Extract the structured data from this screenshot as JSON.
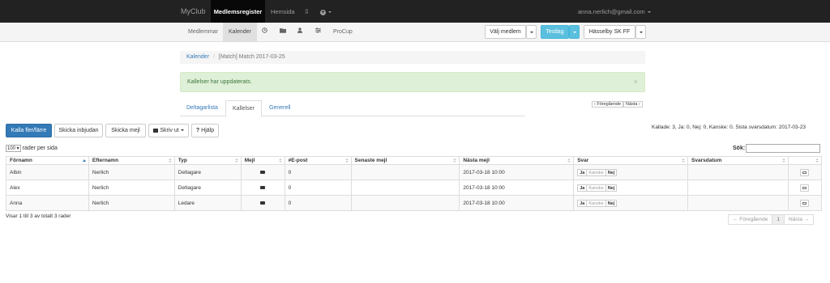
{
  "topnav": {
    "brand": "MyClub",
    "active": "Medlemsregister",
    "hemsida": "Hemsida",
    "user": "anna.nerlich@gmail.com"
  },
  "subnav": {
    "members": "Medlemmar",
    "calendar": "Kalender",
    "procup": "ProCup",
    "valj_medlem": "Välj medlem",
    "testlag": "Testlag",
    "club": "Hässelby SK FF"
  },
  "breadcrumb": {
    "link": "Kalender",
    "sep": "/",
    "current": "[Match] Match 2017-03-25"
  },
  "alert": {
    "text": "Kallelser har uppdaterats.",
    "close": "×"
  },
  "tabs": [
    "Deltagarlista",
    "Kallelser",
    "Generell"
  ],
  "small_pager": {
    "prev": "‹ Föregående",
    "next": "Nästa ›"
  },
  "actions": {
    "kalla": "Kalla fler/färre",
    "skicka_inbjudan": "Skicka inbjudan",
    "skicka_mejl": "Skicka mejl",
    "skriv_ut": "Skriv ut",
    "hjalp": "Hjälp"
  },
  "summary": "Kallade: 3, Ja: 0, Nej: 0, Kanske: 0. Sista svarsdatum: 2017-03-23",
  "length": {
    "value": "100",
    "label": "rader per sida"
  },
  "search": {
    "label": "Sök:",
    "value": ""
  },
  "table": {
    "headers": [
      "Förnamn",
      "Efternamn",
      "Typ",
      "Mejl",
      "#E-post",
      "Senaste mejl",
      "Nästa mejl",
      "Svar",
      "Svarsdatum",
      ""
    ],
    "rows": [
      {
        "fornamn": "Albin",
        "efternamn": "Nerlich",
        "typ": "Deltagare",
        "epost": "0",
        "senaste": "",
        "nasta": "2017-03-18 10:00",
        "svarsdatum": ""
      },
      {
        "fornamn": "Alex",
        "efternamn": "Nerlich",
        "typ": "Deltagare",
        "epost": "0",
        "senaste": "",
        "nasta": "2017-03-18 10:00",
        "svarsdatum": ""
      },
      {
        "fornamn": "Anna",
        "efternamn": "Nerlich",
        "typ": "Ledare",
        "epost": "0",
        "senaste": "",
        "nasta": "2017-03-18 10:00",
        "svarsdatum": ""
      }
    ],
    "svar_buttons": [
      "Ja",
      "Kanske",
      "Nej"
    ]
  },
  "info": "Visar 1 till 3 av totalt 3 rader",
  "pager": {
    "prev": "← Föregående",
    "page": "1",
    "next": "Nästa →"
  },
  "icons": [
    "clock-icon",
    "folder-icon",
    "user-icon",
    "sliders-icon",
    "globe-icon",
    "envelope-icon",
    "print-icon",
    "question-icon",
    "caret-down-icon",
    "sort-asc-icon"
  ],
  "colors": {
    "topbar": "#222222",
    "primary": "#337ab7",
    "info": "#5bc0de",
    "success_bg": "#dff0d8"
  }
}
